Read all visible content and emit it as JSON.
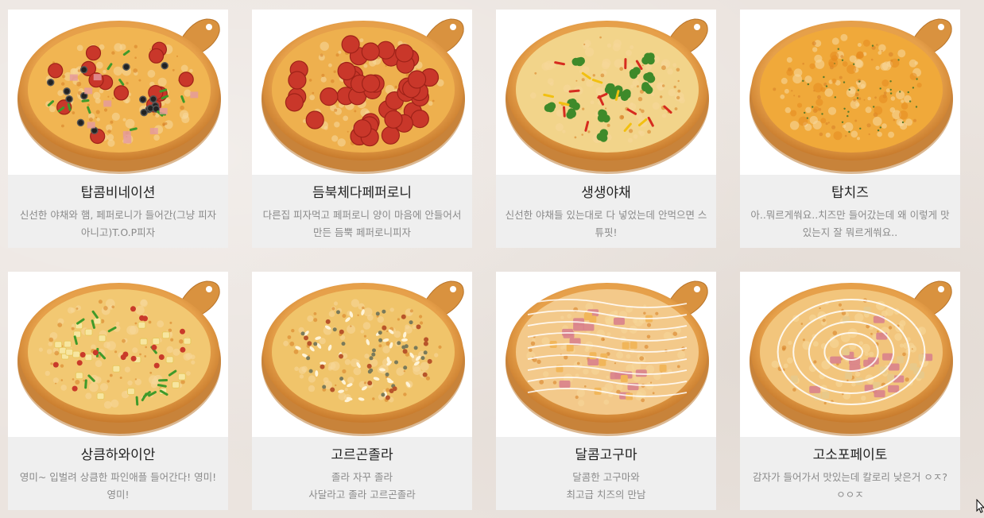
{
  "menu": {
    "items": [
      {
        "name": "탑콤비네이션",
        "desc": "신선한 야채와 햄, 페퍼로니가 들어간(그냥 피자 아니고)T.O.P피자",
        "image": "combination-pizza"
      },
      {
        "name": "듬북체다페퍼로니",
        "desc": "다른집 피자먹고 페퍼로니 양이 마음에 안들어서 만든 듬뿍 페퍼로니피자",
        "image": "pepperoni-pizza"
      },
      {
        "name": "생생야채",
        "desc": "신선한 야채들 있는대로 다 넣었는데 안먹으면 스튜핏!",
        "image": "vegetable-pizza"
      },
      {
        "name": "탑치즈",
        "desc": "아..뭐르게쒀요..치즈만 들어갔는데 왜 이렇게 맛있는지 잘 뭐르게쒀요..",
        "image": "cheese-pizza"
      },
      {
        "name": "상큼하와이안",
        "desc": "영미~ 입벌려 상큼한 파인애플 들어간다! 영미!영미!",
        "image": "hawaiian-pizza"
      },
      {
        "name": "고르곤졸라",
        "desc": "졸라 자꾸 졸라\n사달라고 졸라 고르곤졸라",
        "image": "gorgonzola-pizza"
      },
      {
        "name": "달콤고구마",
        "desc": "달콤한 고구마와\n최고급 치즈의 만남",
        "image": "sweet-potato-pizza"
      },
      {
        "name": "고소포페이토",
        "desc": "감자가 들어가서 맛있는데 칼로리 낮은거 ㅇㅈ?ㅇㅇㅈ",
        "image": "potato-pizza"
      }
    ]
  }
}
